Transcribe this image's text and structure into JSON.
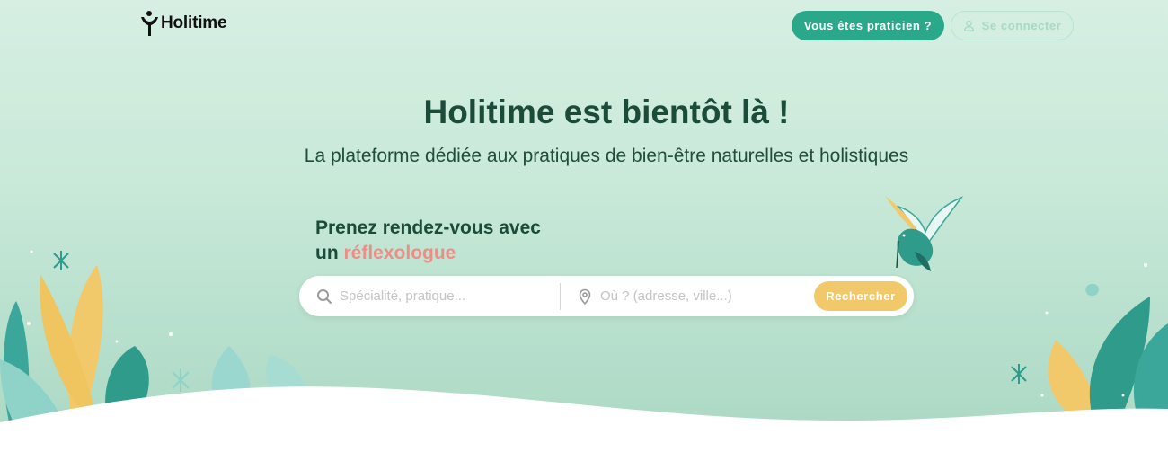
{
  "header": {
    "logo_text": "Holitime",
    "pro_button": "Vous êtes praticien ?",
    "login_button": "Se connecter"
  },
  "hero": {
    "title": "Holitime est bientôt là !",
    "subtitle": "La plateforme dédiée aux pratiques de bien-être naturelles et holistiques"
  },
  "booking": {
    "line1": "Prenez rendez-vous avec",
    "prefix": "un",
    "highlight": "réflexologue"
  },
  "search": {
    "specialty_placeholder": "Spécialité, pratique...",
    "location_placeholder": "Où ? (adresse, ville...)",
    "button": "Rechercher"
  },
  "colors": {
    "brand_green": "#2aa98a",
    "dark_green": "#1b4c39",
    "accent_pink": "#f08c86",
    "accent_yellow": "#f2c96a"
  },
  "icons": [
    "logo-mark-icon",
    "user-icon",
    "search-icon",
    "location-pin-icon",
    "hummingbird-illustration"
  ]
}
